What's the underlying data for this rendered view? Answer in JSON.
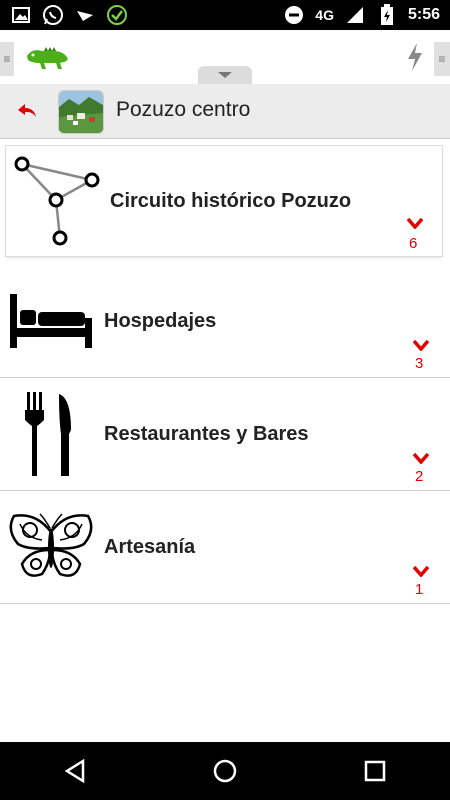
{
  "status_bar": {
    "network": "4G",
    "time": "5:56"
  },
  "breadcrumb": {
    "title": "Pozuzo centro"
  },
  "route_card": {
    "label": "Circuito histórico Pozuzo",
    "count": "6"
  },
  "categories": [
    {
      "label": "Hospedajes",
      "count": "3"
    },
    {
      "label": "Restaurantes y Bares",
      "count": "2"
    },
    {
      "label": "Artesanía",
      "count": "1"
    }
  ],
  "colors": {
    "accent": "#e00000",
    "logo_green": "#4caf1a"
  }
}
